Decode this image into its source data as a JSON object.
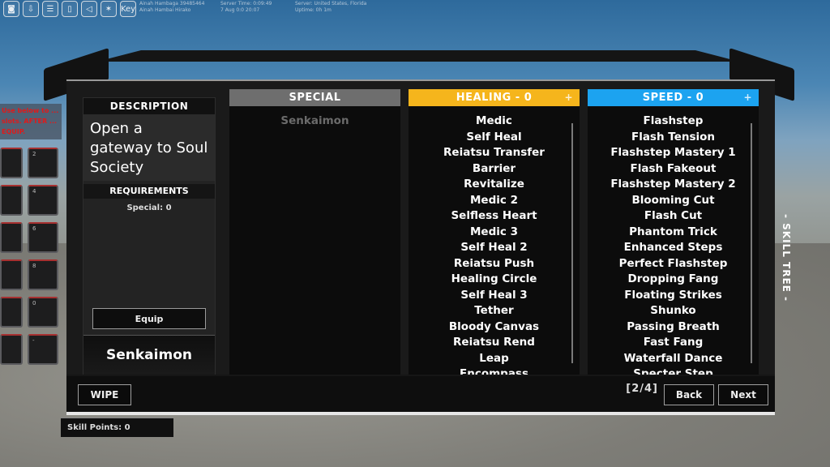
{
  "topbar": {
    "icons": [
      "camera-icon",
      "download-icon",
      "server-icon",
      "door-icon",
      "sound-icon",
      "run-icon",
      "key-icon"
    ],
    "key_label": "Key",
    "info_left": [
      "Ainah Hambaga 39485464",
      "Ainah Hambai Hirako"
    ],
    "info_mid": [
      "Server Time: 0:09:49",
      "7 Aug 0:0 20:07"
    ],
    "info_right": [
      "Server: United States, Florida",
      "Uptime: 0h 1m"
    ]
  },
  "left_note": "Use below to ... slots. AFTER ... EQUIP.",
  "slots": [
    "",
    "2",
    "",
    "4",
    "",
    "6",
    "",
    "8",
    "",
    "0",
    "",
    "-"
  ],
  "description": {
    "header": "DESCRIPTION",
    "text": "Open a gateway to Soul Society",
    "requirements_header": "REQUIREMENTS",
    "requirements_value": "Special: 0",
    "equip_label": "Equip",
    "selected_name": "Senkaimon"
  },
  "columns": [
    {
      "title": "SPECIAL",
      "color": "#6e6e6e",
      "show_plus": false,
      "items": [
        "Senkaimon"
      ]
    },
    {
      "title": "HEALING - 0",
      "color": "#f5b51c",
      "show_plus": true,
      "items": [
        "Medic",
        "Self Heal",
        "Reiatsu Transfer",
        "Barrier",
        "Revitalize",
        "Medic 2",
        "Selfless Heart",
        "Medic 3",
        "Self Heal 2",
        "Reiatsu Push",
        "Healing Circle",
        "Self Heal 3",
        "Tether",
        "Bloody Canvas",
        "Reiatsu Rend",
        "Leap",
        "Encompass"
      ]
    },
    {
      "title": "SPEED - 0",
      "color": "#1ca3f0",
      "show_plus": true,
      "items": [
        "Flashstep",
        "Flash Tension",
        "Flashstep Mastery 1",
        "Flash Fakeout",
        "Flashstep Mastery 2",
        "Blooming Cut",
        "Flash Cut",
        "Phantom Trick",
        "Enhanced Steps",
        "Perfect Flashstep",
        "Dropping Fang",
        "Floating Strikes",
        "Shunko",
        "Passing Breath",
        "Fast Fang",
        "Waterfall Dance",
        "Specter Step"
      ]
    }
  ],
  "plus_glyph": "+",
  "footer": {
    "wipe_label": "WIPE",
    "page_indicator": "[2/4]",
    "back_label": "Back",
    "next_label": "Next"
  },
  "skill_points": "Skill Points: 0",
  "side_label": "- SKILL TREE -"
}
